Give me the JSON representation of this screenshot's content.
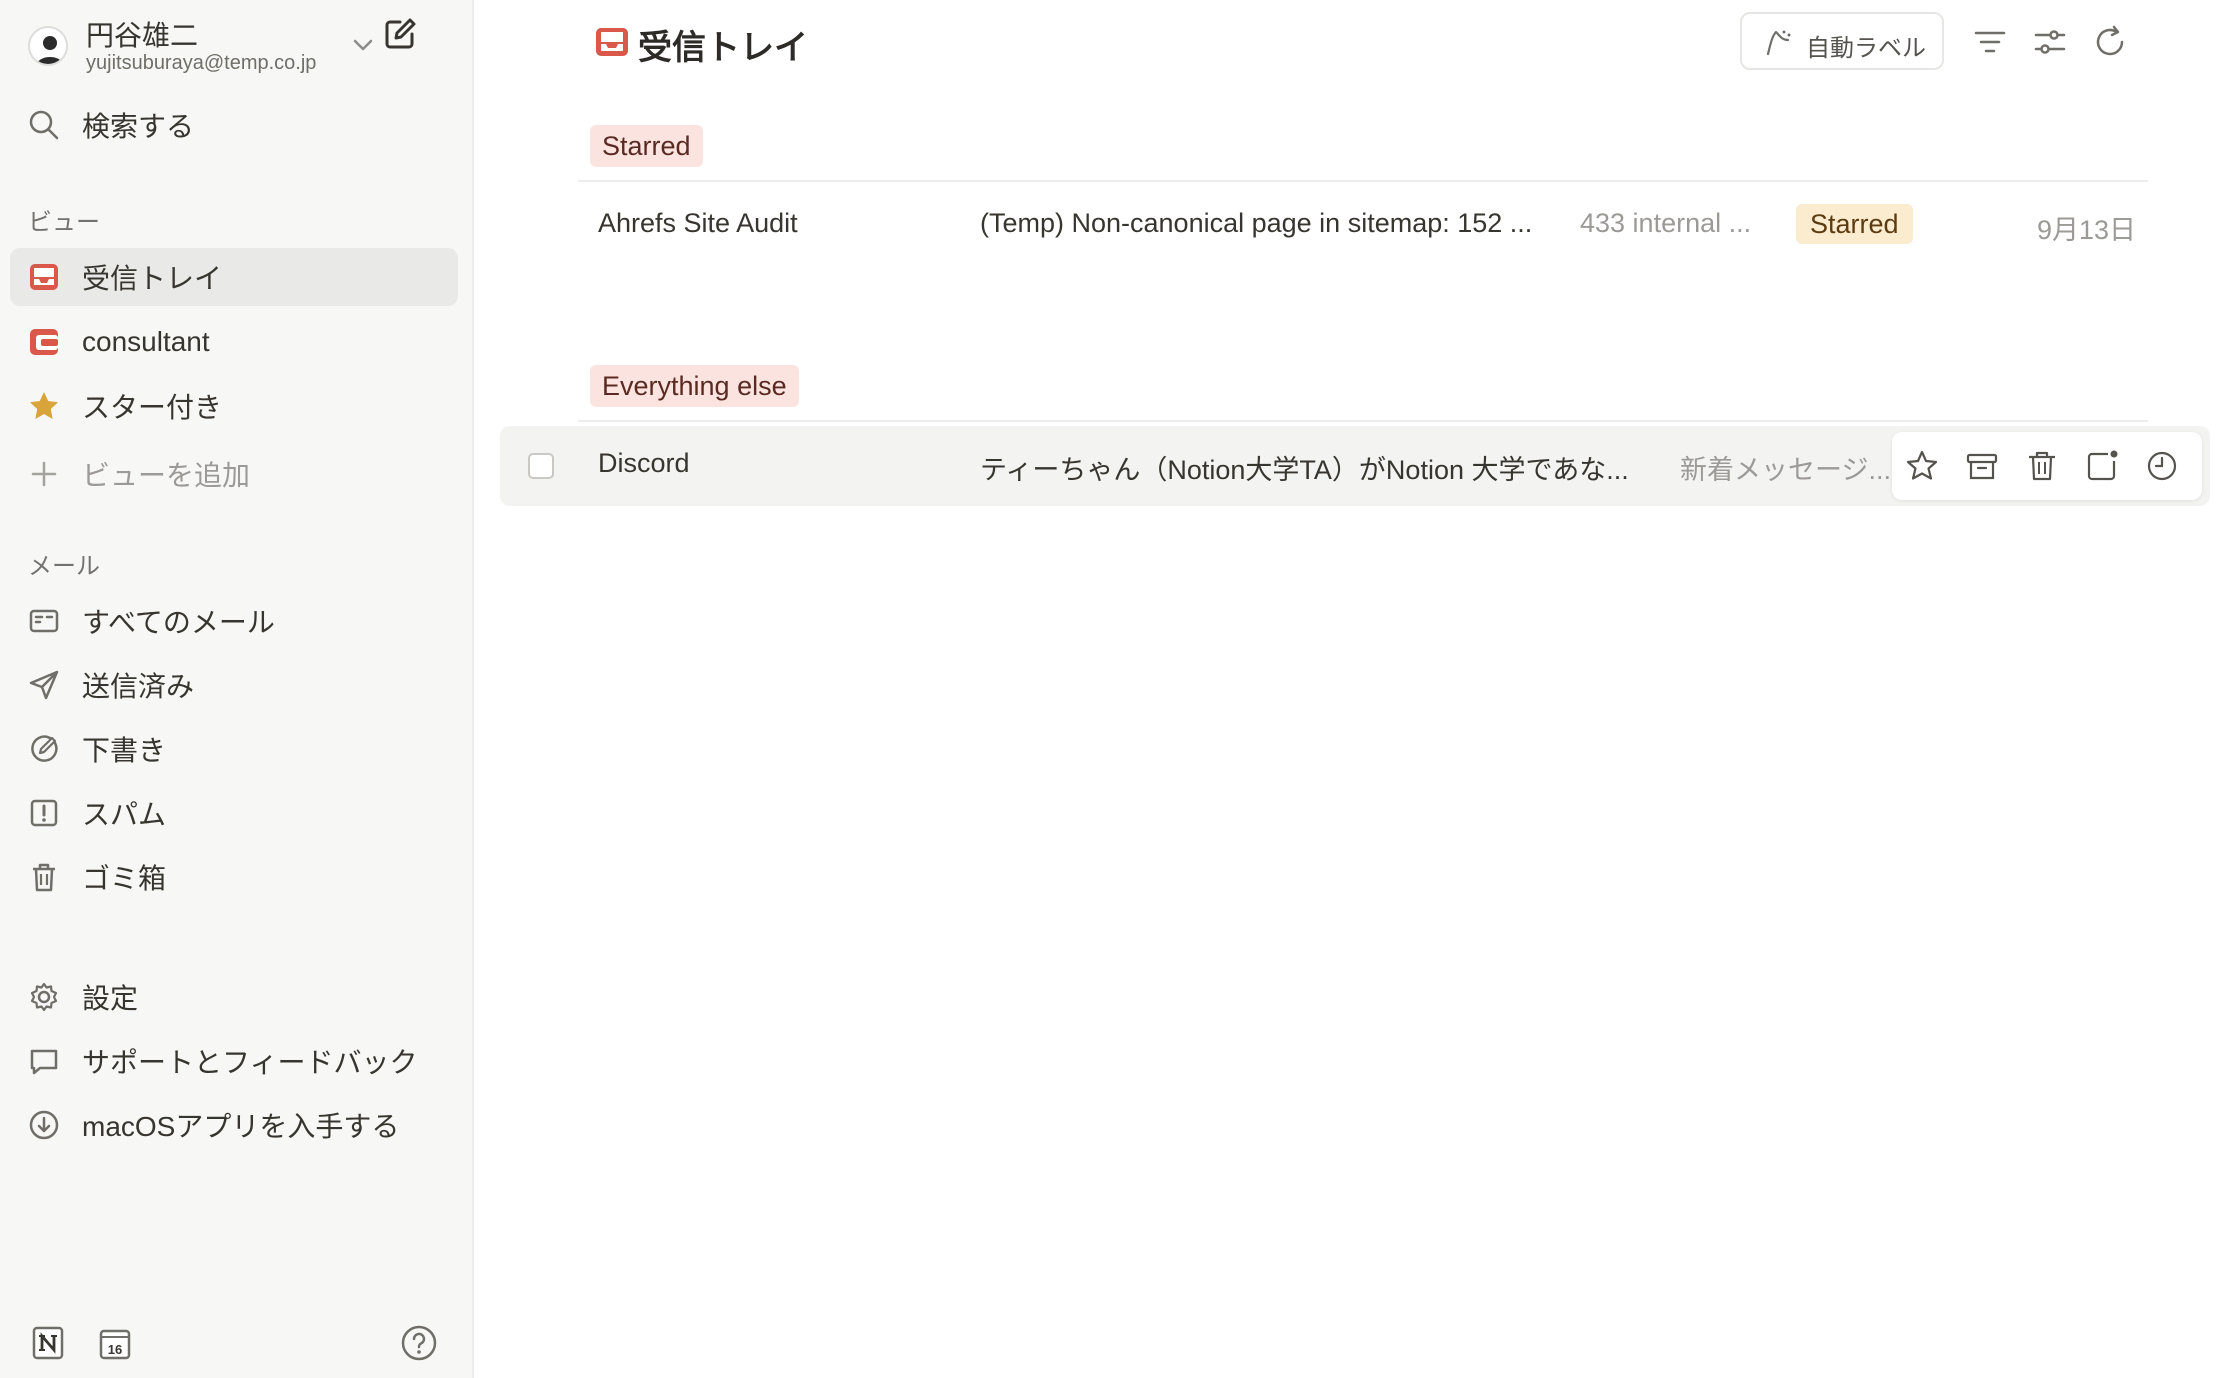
{
  "account": {
    "name": "円谷雄二",
    "email": "yujitsuburaya@temp.co.jp"
  },
  "search": {
    "label": "検索する"
  },
  "views": {
    "section_label": "ビュー",
    "items": [
      {
        "label": "受信トレイ",
        "icon": "inbox-icon",
        "active": true
      },
      {
        "label": "consultant",
        "icon": "label-icon"
      },
      {
        "label": "スター付き",
        "icon": "star-icon"
      }
    ],
    "add_view_label": "ビューを追加"
  },
  "mail": {
    "section_label": "メール",
    "items": [
      {
        "label": "すべてのメール",
        "icon": "all-mail-icon"
      },
      {
        "label": "送信済み",
        "icon": "send-icon"
      },
      {
        "label": "下書き",
        "icon": "draft-icon"
      },
      {
        "label": "スパム",
        "icon": "spam-icon"
      },
      {
        "label": "ゴミ箱",
        "icon": "trash-icon"
      }
    ]
  },
  "footer_links": [
    {
      "label": "設定",
      "icon": "gear-icon"
    },
    {
      "label": "サポートとフィードバック",
      "icon": "chat-icon"
    },
    {
      "label": "macOSアプリを入手する",
      "icon": "download-icon"
    }
  ],
  "header": {
    "title": "受信トレイ",
    "auto_label_button": "自動ラベル"
  },
  "groups": [
    {
      "tag": "Starred",
      "rows": [
        {
          "sender": "Ahrefs Site Audit",
          "subject": "(Temp) Non-canonical page in sitemap: 152 ...",
          "preview": "433 internal ...",
          "badge": "Starred",
          "date": "9月13日"
        }
      ]
    },
    {
      "tag": "Everything else",
      "rows": [
        {
          "sender": "Discord",
          "subject": "ティーちゃん（Notion大学TA）がNotion 大学であな...",
          "preview": "新着メッセージ..."
        }
      ]
    }
  ],
  "colors": {
    "accent_red": "#d9584a",
    "starred_tag_bg": "#fbe4e0",
    "starred_badge_bg": "#fbecd0",
    "star_gold": "#d9a43a",
    "sidebar_bg": "#f7f7f5"
  }
}
